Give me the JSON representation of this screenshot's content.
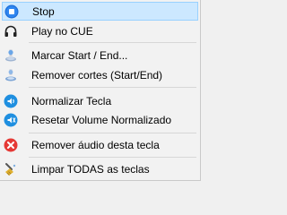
{
  "menu": {
    "items": [
      {
        "label": "Stop",
        "icon": "stop-icon"
      },
      {
        "label": "Play no CUE",
        "icon": "headphones-icon"
      },
      {
        "label": "Marcar Start / End...",
        "icon": "marker-icon"
      },
      {
        "label": "Remover cortes (Start/End)",
        "icon": "remove-cuts-icon"
      },
      {
        "label": "Normalizar Tecla",
        "icon": "normalize-icon"
      },
      {
        "label": "Resetar Volume Normalizado",
        "icon": "reset-volume-icon"
      },
      {
        "label": "Remover áudio desta tecla",
        "icon": "remove-audio-icon"
      },
      {
        "label": "Limpar TODAS as teclas",
        "icon": "broom-icon"
      }
    ]
  },
  "colors": {
    "highlight_bg": "#cce8ff",
    "highlight_border": "#99d1ff",
    "stop_blue": "#1e6fd9",
    "normalize_blue": "#1f8fe0",
    "remove_red": "#e53935"
  }
}
